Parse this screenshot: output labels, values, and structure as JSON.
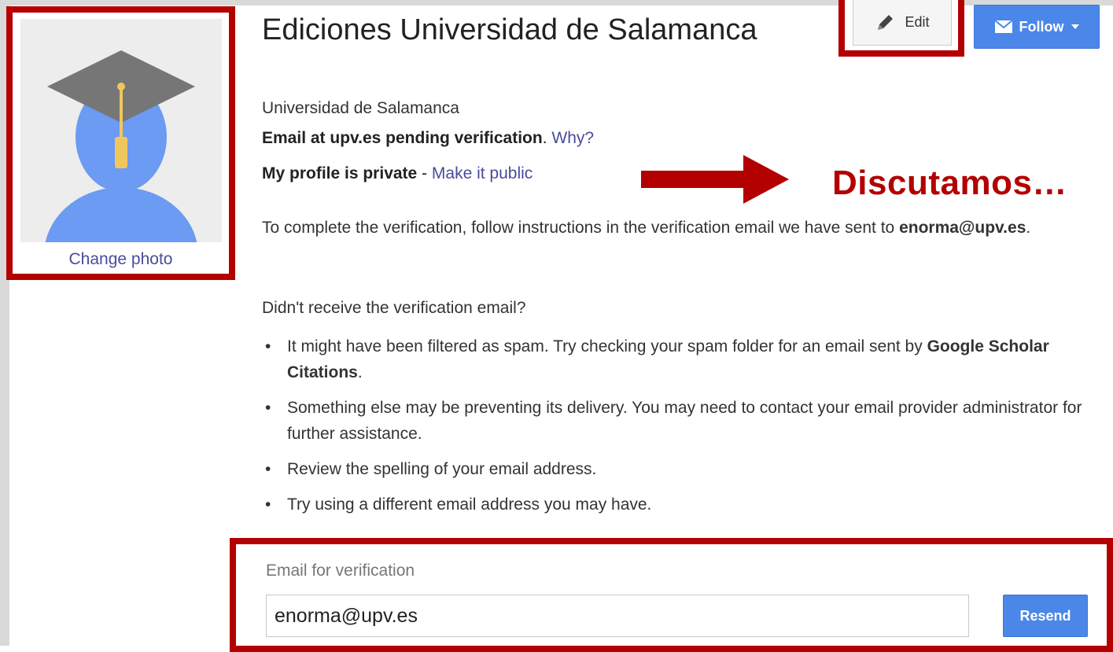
{
  "profile": {
    "name": "Ediciones Universidad de Salamanca",
    "affiliation": "Universidad de Salamanca",
    "verify_status": "Email at upv.es pending verification",
    "verify_status_suffix": ".",
    "why_link": "Why?",
    "private_status": "My profile is private",
    "private_sep": " - ",
    "make_public_link": "Make it public",
    "change_photo": "Change photo"
  },
  "header_actions": {
    "edit_label": "Edit",
    "follow_label": "Follow"
  },
  "annotation": {
    "text": "Discutamos…"
  },
  "instructions": {
    "complete_prefix": "To complete the verification, follow instructions in the verification email we have sent to ",
    "email": "enorma@upv.es",
    "complete_suffix": ".",
    "didnt_receive": "Didn't receive the verification email?",
    "bullet1_prefix": "It might have been filtered as spam. Try checking your spam folder for an email sent by ",
    "bullet1_bold": "Google Scholar Citations",
    "bullet1_suffix": ".",
    "bullet2": "Something else may be preventing its delivery. You may need to contact your email provider administrator for further assistance.",
    "bullet3": "Review the spelling of your email address.",
    "bullet4": "Try using a different email address you may have.",
    "bullet_glyph": "•"
  },
  "verification_form": {
    "label": "Email for verification",
    "email_value": "enorma@upv.es",
    "resend_label": "Resend"
  },
  "colors": {
    "highlight_red": "#b30000",
    "button_blue": "#4a87e8",
    "link_purple": "#4b4b9a",
    "avatar_blue": "#6b9bf2"
  },
  "icons": {
    "avatar": "graduation-cap-avatar-icon",
    "edit": "pencil-icon",
    "follow": "envelope-icon",
    "dropdown": "caret-down-icon",
    "arrow": "arrow-right-icon"
  }
}
